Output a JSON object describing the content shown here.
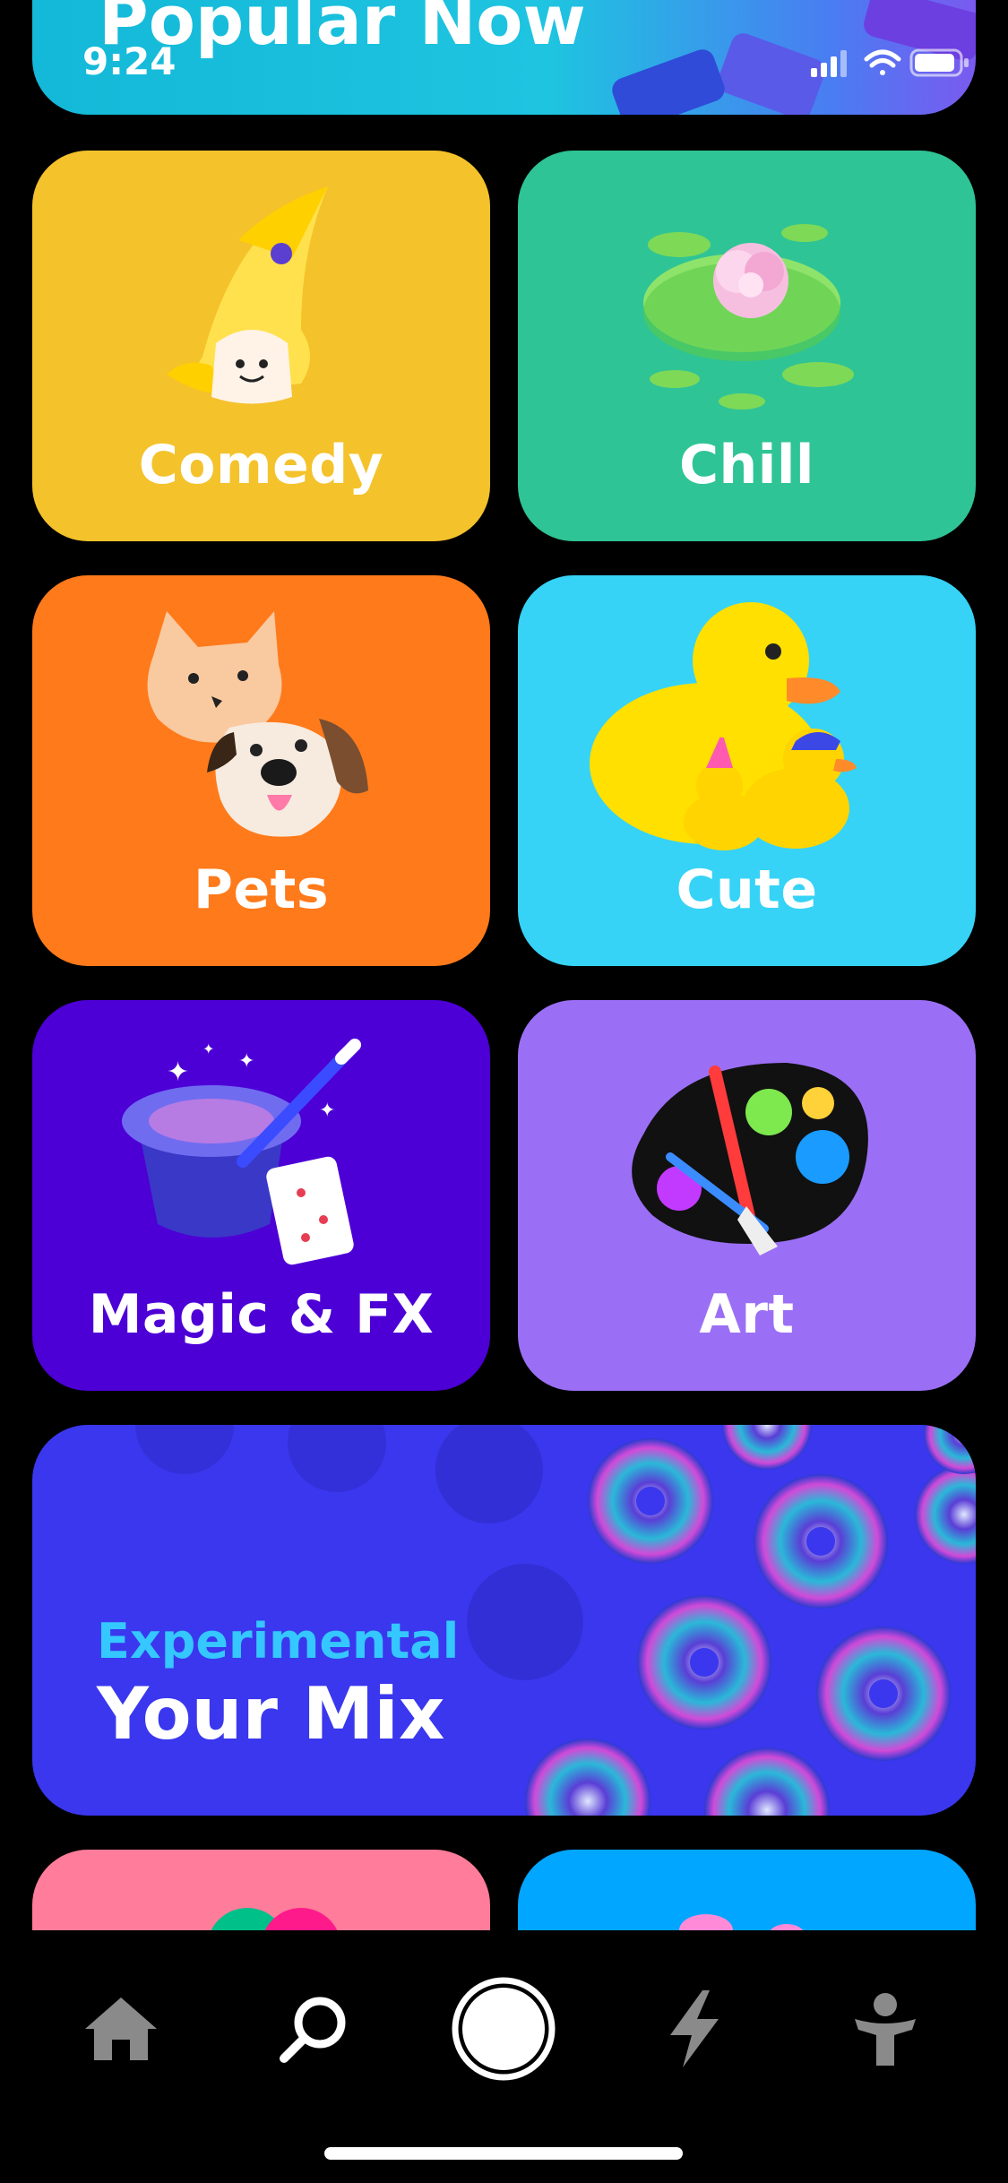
{
  "status_bar": {
    "time": "9:24"
  },
  "header": {
    "title": "Popular Now"
  },
  "tiles": [
    {
      "label": "Comedy",
      "icon": "banana-ghost-icon",
      "color": "#f4c22b"
    },
    {
      "label": "Chill",
      "icon": "lotus-lilypad-icon",
      "color": "#2fc495"
    },
    {
      "label": "Pets",
      "icon": "cat-dog-icon",
      "color": "#ff7a1a"
    },
    {
      "label": "Cute",
      "icon": "rubber-duck-icon",
      "color": "#36d3f6"
    },
    {
      "label": "Magic & FX",
      "icon": "magic-hat-icon",
      "color": "#4d00d6"
    },
    {
      "label": "Art",
      "icon": "paint-palette-icon",
      "color": "#9b6ff5"
    }
  ],
  "mix_card": {
    "subtitle": "Experimental",
    "title": "Your Mix",
    "color": "#3a37ee",
    "subtitle_color": "#35c7ff"
  },
  "bottom_nav": [
    {
      "name": "home",
      "icon": "home-icon"
    },
    {
      "name": "search",
      "icon": "search-icon"
    },
    {
      "name": "camera",
      "icon": "capture-icon"
    },
    {
      "name": "spotlight",
      "icon": "lightning-icon"
    },
    {
      "name": "profile",
      "icon": "person-icon"
    }
  ]
}
